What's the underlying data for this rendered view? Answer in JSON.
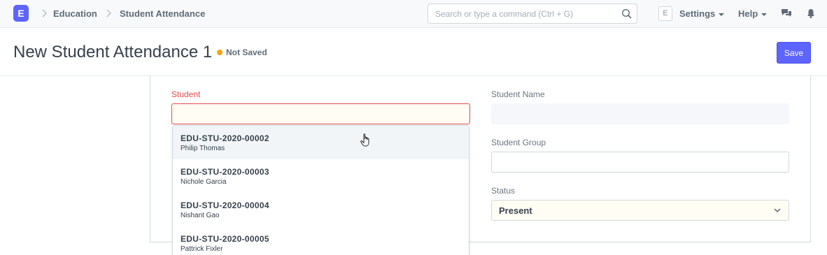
{
  "navbar": {
    "logo_letter": "E",
    "breadcrumbs": [
      "Education",
      "Student Attendance"
    ],
    "search_placeholder": "Search or type a command (Ctrl + G)",
    "avatar_letter": "E",
    "settings_label": "Settings",
    "help_label": "Help",
    "icons": [
      "chat-icon",
      "bell-icon"
    ]
  },
  "page": {
    "title": "New Student Attendance 1",
    "status": "Not Saved",
    "status_color": "#ffa00a",
    "save_label": "Save"
  },
  "form": {
    "student_label": "Student",
    "student_value": "",
    "student_name_label": "Student Name",
    "student_group_label": "Student Group",
    "student_group_value": "",
    "status_label": "Status",
    "status_value": "Present"
  },
  "dropdown": {
    "items": [
      {
        "id": "EDU-STU-2020-00002",
        "name": "Philip Thomas"
      },
      {
        "id": "EDU-STU-2020-00003",
        "name": "Nichole Garcia"
      },
      {
        "id": "EDU-STU-2020-00004",
        "name": "Nishant Gao"
      },
      {
        "id": "EDU-STU-2020-00005",
        "name": "Pattrick Fixler"
      }
    ]
  },
  "colors": {
    "accent": "#5e64ff",
    "error": "#e24c4c",
    "text": "#36414c"
  }
}
